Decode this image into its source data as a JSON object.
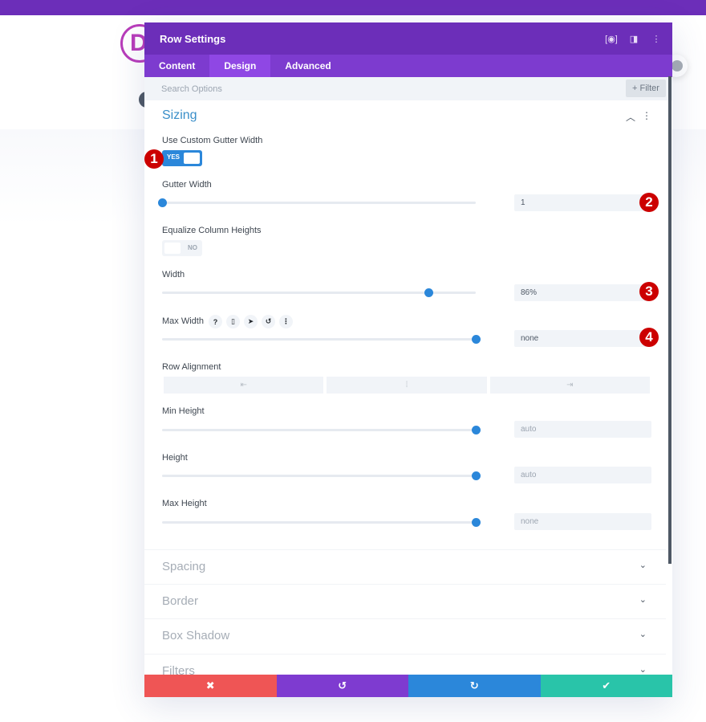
{
  "background": {
    "logo_letter": "D"
  },
  "modal": {
    "title": "Row Settings",
    "header_icons": [
      "fullscreen-icon",
      "split-view-icon",
      "more-options-icon"
    ],
    "tabs": [
      {
        "label": "Content",
        "active": false
      },
      {
        "label": "Design",
        "active": true
      },
      {
        "label": "Advanced",
        "active": false
      }
    ],
    "search": {
      "placeholder": "Search Options",
      "filter_label": "+ Filter"
    },
    "section": {
      "title": "Sizing",
      "expanded": true,
      "fields": {
        "custom_gutter": {
          "label": "Use Custom Gutter Width",
          "value": "YES",
          "on": true,
          "badge": "1"
        },
        "gutter_width": {
          "label": "Gutter Width",
          "value": "1",
          "slider": 0.0,
          "badge": "2"
        },
        "equalize": {
          "label": "Equalize Column Heights",
          "value": "NO",
          "on": false
        },
        "width": {
          "label": "Width",
          "value": "86%",
          "slider": 0.85,
          "badge": "3"
        },
        "max_width": {
          "label": "Max Width",
          "value": "none",
          "slider": 1.0,
          "badge": "4",
          "icons": [
            "help-icon",
            "mobile-icon",
            "cursor-icon",
            "reset-icon",
            "more-options-icon"
          ]
        },
        "row_alignment": {
          "label": "Row Alignment",
          "options": [
            "left-align-icon",
            "center-align-icon",
            "right-align-icon"
          ]
        },
        "min_height": {
          "label": "Min Height",
          "value": "auto",
          "slider": 1.0
        },
        "height": {
          "label": "Height",
          "value": "auto",
          "slider": 1.0
        },
        "max_height": {
          "label": "Max Height",
          "value": "none",
          "slider": 1.0
        }
      }
    },
    "collapsed_sections": [
      "Spacing",
      "Border",
      "Box Shadow",
      "Filters"
    ],
    "footer": {
      "buttons": [
        {
          "name": "cancel",
          "glyph": "✖",
          "color": "#ef5555"
        },
        {
          "name": "undo",
          "glyph": "↺",
          "color": "#7e3bd0"
        },
        {
          "name": "redo",
          "glyph": "↻",
          "color": "#2b87da"
        },
        {
          "name": "save",
          "glyph": "✔",
          "color": "#29c4a9"
        }
      ]
    }
  },
  "colors": {
    "primary_purple": "#6c2eb9",
    "tab_purple": "#7d3bcf",
    "accent_blue": "#2b87da",
    "badge_red": "#cc0000"
  }
}
